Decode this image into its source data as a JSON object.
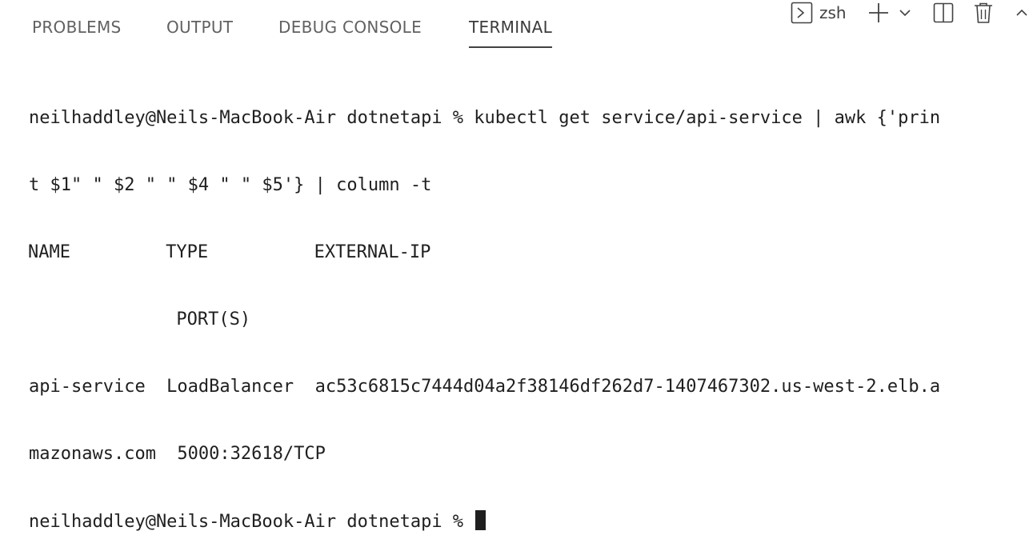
{
  "panel": {
    "tabs": [
      {
        "label": "PROBLEMS",
        "active": false
      },
      {
        "label": "OUTPUT",
        "active": false
      },
      {
        "label": "DEBUG CONSOLE",
        "active": false
      },
      {
        "label": "TERMINAL",
        "active": true
      }
    ],
    "actions": {
      "shell_name": "zsh",
      "icons": [
        "terminal-icon",
        "plus-icon",
        "chevron-down-icon",
        "split-icon",
        "trash-icon",
        "chevron-up-icon"
      ]
    }
  },
  "terminal": {
    "lines": [
      "neilhaddley@Neils-MacBook-Air dotnetapi % kubectl get service/api-service | awk {'prin",
      "t $1\" \" $2 \" \" $4 \" \" $5'} | column -t",
      "NAME         TYPE          EXTERNAL-IP",
      "              PORT(S)",
      "api-service  LoadBalancer  ac53c6815c7444d04a2f38146df262d7-1407467302.us-west-2.elb.a",
      "mazonaws.com  5000:32618/TCP",
      "neilhaddley@Neils-MacBook-Air dotnetapi % "
    ]
  },
  "colors": {
    "background": "#ffffff",
    "text": "#1f1f1f",
    "tab_inactive": "#616161",
    "tab_active_underline": "#424242"
  }
}
